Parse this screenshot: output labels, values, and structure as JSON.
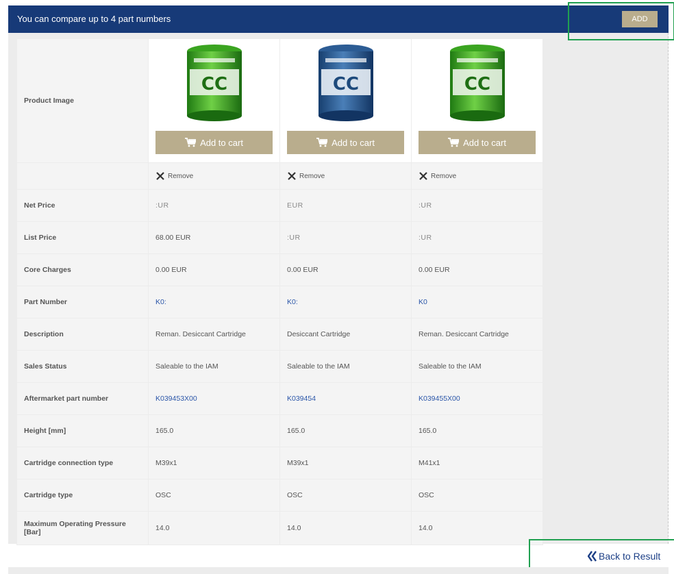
{
  "header": {
    "title": "You can compare up to 4 part numbers",
    "add_label": "ADD"
  },
  "colors": {
    "header_bg": "#173a78",
    "button_bg": "#b9ad8d",
    "link": "#2a55a8",
    "highlight": "#20a050"
  },
  "product_image_label": "Product Image",
  "products": [
    {
      "can_color": "green",
      "add_to_cart": "Add to cart",
      "remove": "Remove"
    },
    {
      "can_color": "blue",
      "add_to_cart": "Add to cart",
      "remove": "Remove"
    },
    {
      "can_color": "green",
      "add_to_cart": "Add to cart",
      "remove": "Remove"
    }
  ],
  "rows": [
    {
      "label": "Net Price",
      "values": [
        ":UR",
        "EUR",
        ":UR"
      ]
    },
    {
      "label": "List Price",
      "values": [
        "68.00 EUR",
        ":UR",
        ":UR"
      ]
    },
    {
      "label": "Core Charges",
      "values": [
        "0.00 EUR",
        "0.00 EUR",
        "0.00 EUR"
      ]
    },
    {
      "label": "Part Number",
      "values": [
        "K0:",
        "K0:",
        "K0"
      ]
    },
    {
      "label": "Description",
      "values": [
        "Reman. Desiccant Cartridge",
        "Desiccant Cartridge",
        "Reman. Desiccant Cartridge"
      ]
    },
    {
      "label": "Sales Status",
      "values": [
        "Saleable to the IAM",
        "Saleable to the IAM",
        "Saleable to the IAM"
      ]
    },
    {
      "label": "Aftermarket part number",
      "values": [
        "K039453X00",
        "K039454",
        "K039455X00"
      ]
    },
    {
      "label": "Height [mm]",
      "values": [
        "165.0",
        "165.0",
        "165.0"
      ]
    },
    {
      "label": "Cartridge connection type",
      "values": [
        "M39x1",
        "M39x1",
        "M41x1"
      ]
    },
    {
      "label": "Cartridge type",
      "values": [
        "OSC",
        "OSC",
        "OSC"
      ]
    },
    {
      "label": "Maximum Operating Pressure [Bar]",
      "values": [
        "14.0",
        "14.0",
        "14.0"
      ]
    }
  ],
  "footer": {
    "back_label": "Back to Result"
  }
}
